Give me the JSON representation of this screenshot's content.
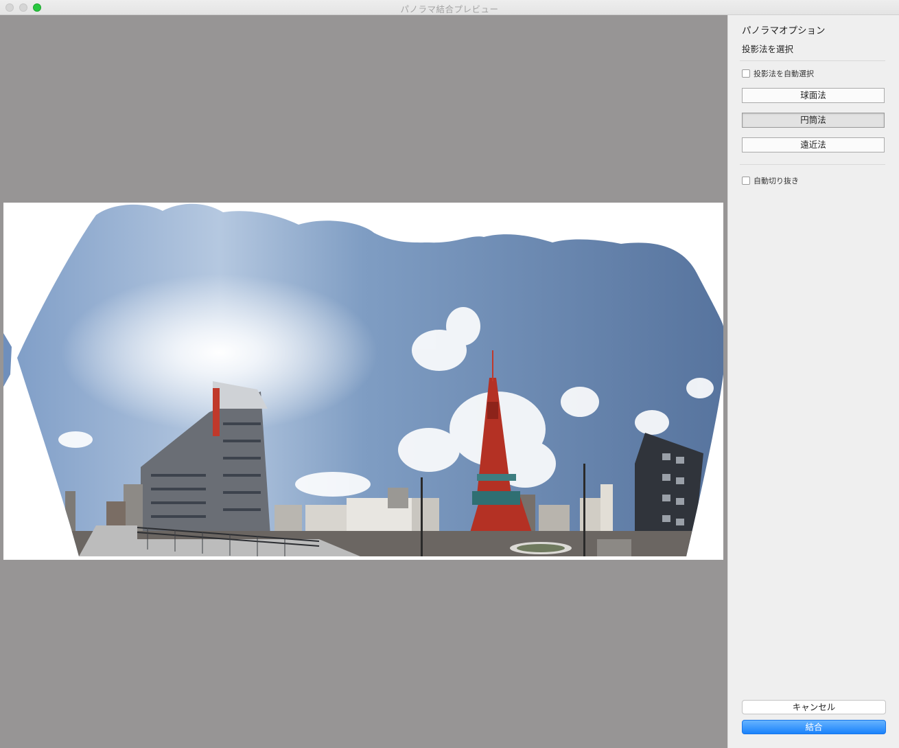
{
  "window": {
    "title": "パノラマ結合プレビュー"
  },
  "sidebar": {
    "title": "パノラマオプション",
    "subtitle": "投影法を選択",
    "auto_select_label": "投影法を自動選択",
    "auto_select_checked": false,
    "projections": [
      {
        "label": "球面法",
        "selected": false
      },
      {
        "label": "円筒法",
        "selected": true
      },
      {
        "label": "遠近法",
        "selected": false
      }
    ],
    "auto_crop_label": "自動切り抜き",
    "auto_crop_checked": false
  },
  "footer": {
    "cancel_label": "キャンセル",
    "merge_label": "結合"
  },
  "colors": {
    "accent": "#1a82fb",
    "preview_background": "#979595",
    "sky_top": "#5e7ea9",
    "tower": "#c0392b"
  }
}
